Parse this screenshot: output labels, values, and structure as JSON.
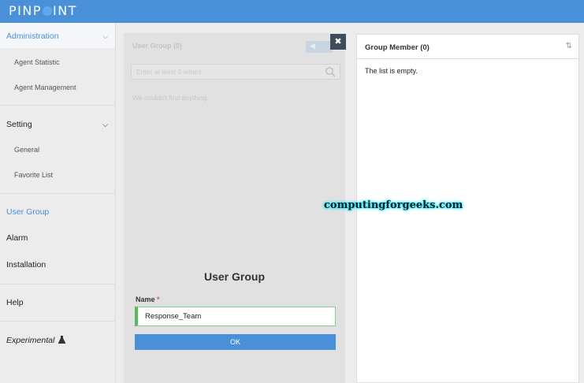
{
  "app": {
    "logo_text_left": "PINP",
    "logo_text_right": "INT"
  },
  "sidebar": {
    "administration": "Administration",
    "agent_statistic": "Agent Statistic",
    "agent_management": "Agent Management",
    "setting": "Setting",
    "general": "General",
    "favorite_list": "Favorite List",
    "user_group": "User Group",
    "alarm": "Alarm",
    "installation": "Installation",
    "help": "Help",
    "experimental": "Experimental"
  },
  "user_group_list": {
    "title": "User Group (0)",
    "search_placeholder": "Enter at least 3 letters",
    "empty_text": "We couldn't find anything."
  },
  "create_form": {
    "title": "User Group",
    "name_label": "Name",
    "required_mark": "*",
    "name_value": "Response_Team",
    "ok_label": "OK"
  },
  "group_member": {
    "title": "Group Member (0)",
    "empty_text": "The list is empty."
  },
  "watermark": "computingforgeeks.com",
  "colors": {
    "accent": "#4a90d9",
    "overlay": "#e1e1e1",
    "input_valid": "#5cb85c"
  }
}
